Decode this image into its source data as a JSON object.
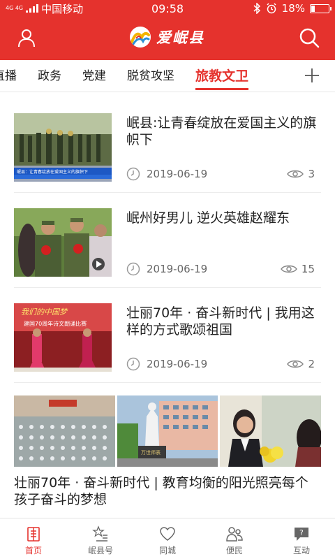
{
  "status_bar": {
    "signal_label": "4G 4G",
    "carrier": "中国移动",
    "time": "09:58",
    "battery_percent": "18%",
    "battery_level": 0.18,
    "icons": [
      "signal-icon",
      "bluetooth-icon",
      "alarm-icon",
      "battery-icon"
    ]
  },
  "header": {
    "app_name": "爱岷县",
    "left_icon": "user-icon",
    "right_icon": "search-icon"
  },
  "tabs": {
    "items": [
      {
        "label": "直播",
        "active": false
      },
      {
        "label": "政务",
        "active": false
      },
      {
        "label": "党建",
        "active": false
      },
      {
        "label": "脱贫攻坚",
        "active": false
      },
      {
        "label": "旅教文卫",
        "active": true
      }
    ],
    "add_icon": "plus-icon"
  },
  "news": [
    {
      "title": "岷县:让青春绽放在爱国主义的旗帜下",
      "date": "2019-06-19",
      "views": "3"
    },
    {
      "title": "岷州好男儿 逆火英雄赵耀东",
      "date": "2019-06-19",
      "views": "15"
    },
    {
      "title": "壮丽70年 · 奋斗新时代 | 我用这样的方式歌颂祖国",
      "date": "2019-06-19",
      "views": "2"
    }
  ],
  "thumb_text": {
    "caption1": "岷县：让青春绽放在爱国主义的旗帜下",
    "banner3_line1": "我们的中国梦",
    "banner3_line2": "建国70周年诗文朗诵比赛",
    "stone_text": "万世师表"
  },
  "featured": {
    "title": "壮丽70年 · 奋斗新时代 | 教育均衡的阳光照亮每个孩子奋斗的梦想"
  },
  "bottom_nav": [
    {
      "label": "首页",
      "icon": "home-icon",
      "active": true
    },
    {
      "label": "岷县号",
      "icon": "star-list-icon",
      "active": false
    },
    {
      "label": "同城",
      "icon": "heart-icon",
      "active": false
    },
    {
      "label": "便民",
      "icon": "people-icon",
      "active": false
    },
    {
      "label": "互动",
      "icon": "chat-icon",
      "active": false
    }
  ],
  "colors": {
    "accent": "#e5322d",
    "text": "#222222",
    "muted": "#666666"
  }
}
